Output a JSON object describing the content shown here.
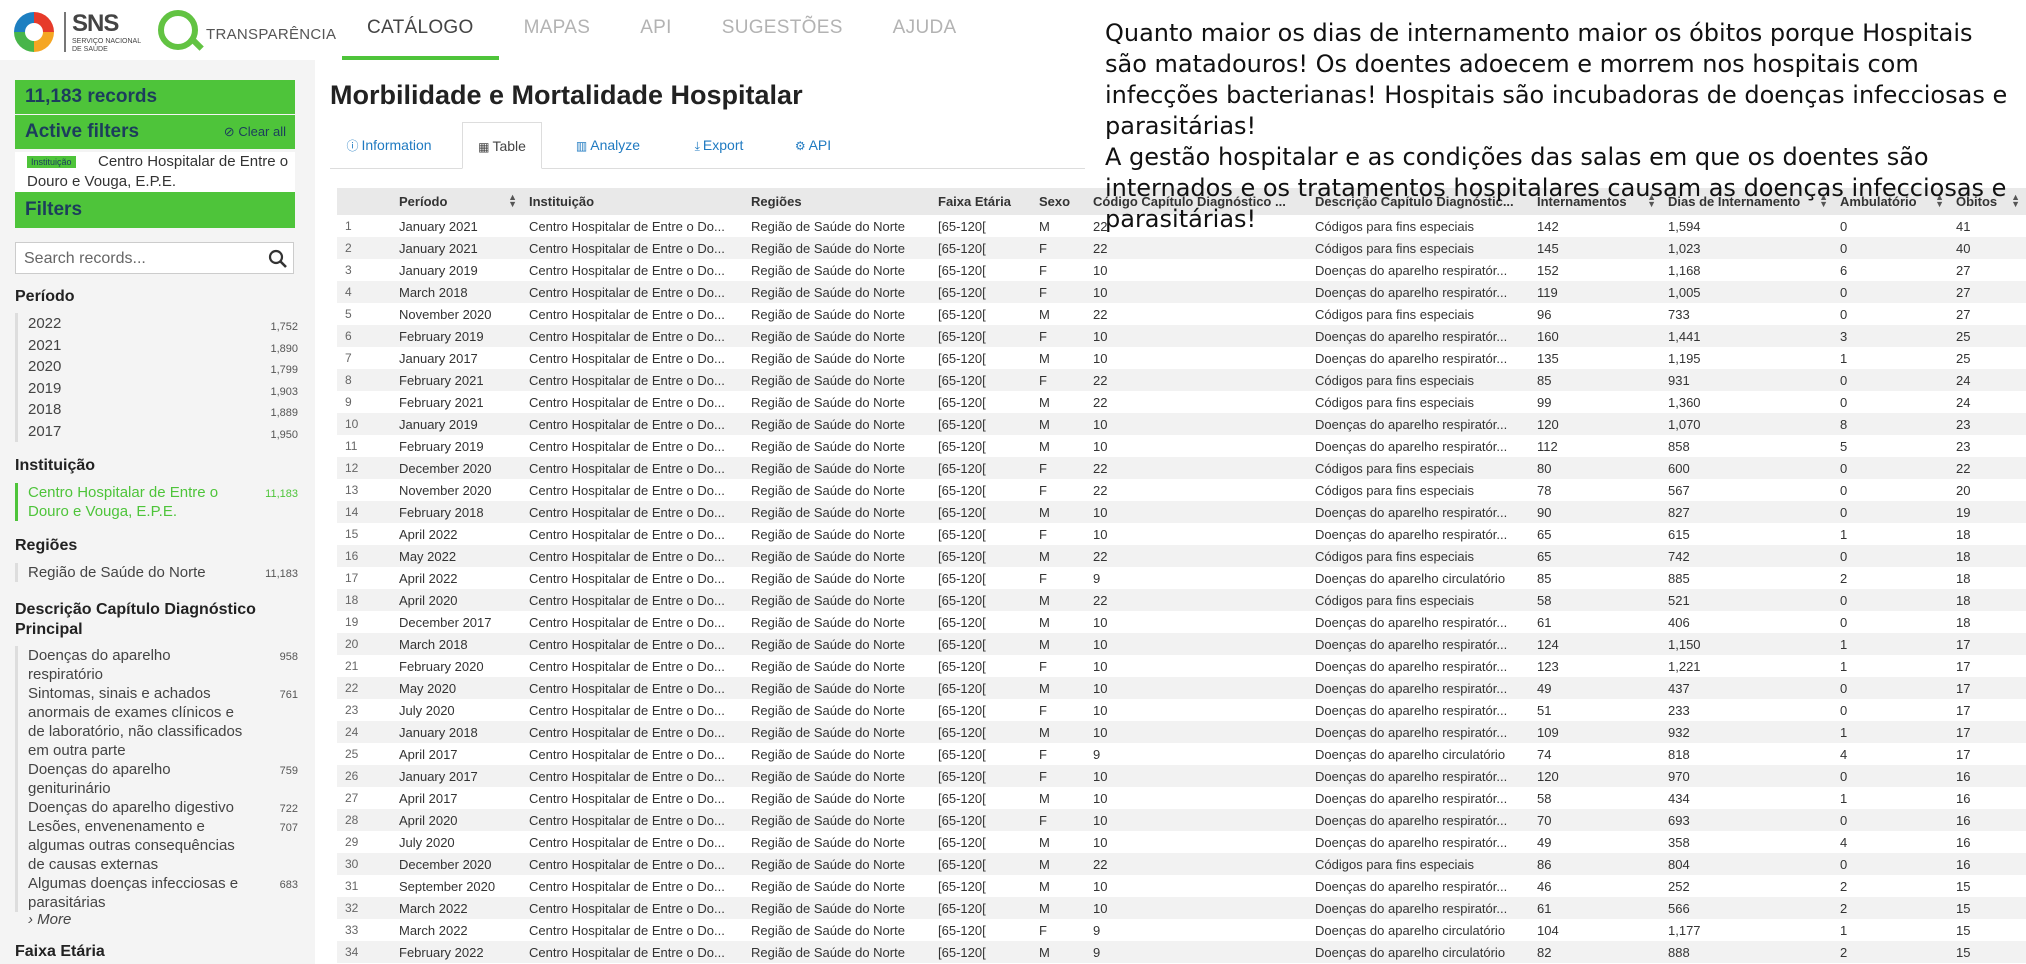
{
  "brand": {
    "sns_title": "SNS",
    "sns_subtitle": "SERVIÇO NACIONAL DE SAÚDE",
    "transparencia": "TRANSPARÊNCIA"
  },
  "nav": {
    "items": [
      "CATÁLOGO",
      "MAPAS",
      "API",
      "SUGESTÕES",
      "AJUDA"
    ],
    "active": "CATÁLOGO"
  },
  "sidebar": {
    "records": "11,183 records",
    "active_filters": "Active filters",
    "clear_all": "Clear all",
    "filter_tag": "Instituição",
    "filter_value": "Centro Hospitalar de Entre o Douro e Vouga, E.P.E.",
    "filters": "Filters",
    "search_placeholder": "Search records...",
    "facets": {
      "periodo": {
        "title": "Período",
        "items": [
          {
            "label": "2022",
            "count": "1,752"
          },
          {
            "label": "2021",
            "count": "1,890"
          },
          {
            "label": "2020",
            "count": "1,799"
          },
          {
            "label": "2019",
            "count": "1,903"
          },
          {
            "label": "2018",
            "count": "1,889"
          },
          {
            "label": "2017",
            "count": "1,950"
          }
        ]
      },
      "instituicao": {
        "title": "Instituição",
        "items": [
          {
            "label": "Centro Hospitalar de Entre o Douro e Vouga, E.P.E.",
            "count": "11,183"
          }
        ]
      },
      "regioes": {
        "title": "Regiões",
        "items": [
          {
            "label": "Região de Saúde do Norte",
            "count": "11,183"
          }
        ]
      },
      "descricao": {
        "title": "Descrição Capítulo Diagnóstico Principal",
        "items": [
          {
            "label": "Doenças do aparelho respiratório",
            "count": "958"
          },
          {
            "label": "Sintomas, sinais e achados anormais de exames clínicos e de laboratório, não classificados em outra parte",
            "count": "761"
          },
          {
            "label": "Doenças do aparelho geniturinário",
            "count": "759"
          },
          {
            "label": "Doenças do aparelho digestivo",
            "count": "722"
          },
          {
            "label": "Lesões, envenenamento e algumas outras consequências de causas externas",
            "count": "707"
          },
          {
            "label": "Algumas doenças infecciosas e parasitárias",
            "count": "683"
          }
        ],
        "more": "› More"
      },
      "faixa": {
        "title": "Faixa Etária"
      }
    }
  },
  "main": {
    "title": "Morbilidade e Mortalidade Hospitalar",
    "tabs": [
      {
        "label": "Information",
        "icon": "info-icon"
      },
      {
        "label": "Table",
        "icon": "table-icon"
      },
      {
        "label": "Analyze",
        "icon": "bar-chart-icon"
      },
      {
        "label": "Export",
        "icon": "download-icon"
      },
      {
        "label": "API",
        "icon": "gears-icon"
      }
    ],
    "active_tab": "Table"
  },
  "table": {
    "headers": [
      "Período",
      "Instituição",
      "Regiões",
      "Faixa Etária",
      "Sexo",
      "Código Capítulo Diagnóstico ...",
      "Descrição Capítulo Diagnóstic...",
      "Internamentos",
      "Dias de Internamento",
      "Ambulatório",
      "Óbitos"
    ],
    "rows": [
      [
        "1",
        "January 2021",
        "Centro Hospitalar de Entre o Do...",
        "Região de Saúde do Norte",
        "[65-120[",
        "M",
        "22",
        "Códigos para fins especiais",
        "142",
        "1,594",
        "0",
        "41"
      ],
      [
        "2",
        "January 2021",
        "Centro Hospitalar de Entre o Do...",
        "Região de Saúde do Norte",
        "[65-120[",
        "F",
        "22",
        "Códigos para fins especiais",
        "145",
        "1,023",
        "0",
        "40"
      ],
      [
        "3",
        "January 2019",
        "Centro Hospitalar de Entre o Do...",
        "Região de Saúde do Norte",
        "[65-120[",
        "F",
        "10",
        "Doenças do aparelho respiratór...",
        "152",
        "1,168",
        "6",
        "27"
      ],
      [
        "4",
        "March 2018",
        "Centro Hospitalar de Entre o Do...",
        "Região de Saúde do Norte",
        "[65-120[",
        "F",
        "10",
        "Doenças do aparelho respiratór...",
        "119",
        "1,005",
        "0",
        "27"
      ],
      [
        "5",
        "November 2020",
        "Centro Hospitalar de Entre o Do...",
        "Região de Saúde do Norte",
        "[65-120[",
        "M",
        "22",
        "Códigos para fins especiais",
        "96",
        "733",
        "0",
        "27"
      ],
      [
        "6",
        "February 2019",
        "Centro Hospitalar de Entre o Do...",
        "Região de Saúde do Norte",
        "[65-120[",
        "F",
        "10",
        "Doenças do aparelho respiratór...",
        "160",
        "1,441",
        "3",
        "25"
      ],
      [
        "7",
        "January 2017",
        "Centro Hospitalar de Entre o Do...",
        "Região de Saúde do Norte",
        "[65-120[",
        "M",
        "10",
        "Doenças do aparelho respiratór...",
        "135",
        "1,195",
        "1",
        "25"
      ],
      [
        "8",
        "February 2021",
        "Centro Hospitalar de Entre o Do...",
        "Região de Saúde do Norte",
        "[65-120[",
        "F",
        "22",
        "Códigos para fins especiais",
        "85",
        "931",
        "0",
        "24"
      ],
      [
        "9",
        "February 2021",
        "Centro Hospitalar de Entre o Do...",
        "Região de Saúde do Norte",
        "[65-120[",
        "M",
        "22",
        "Códigos para fins especiais",
        "99",
        "1,360",
        "0",
        "24"
      ],
      [
        "10",
        "January 2019",
        "Centro Hospitalar de Entre o Do...",
        "Região de Saúde do Norte",
        "[65-120[",
        "M",
        "10",
        "Doenças do aparelho respiratór...",
        "120",
        "1,070",
        "8",
        "23"
      ],
      [
        "11",
        "February 2019",
        "Centro Hospitalar de Entre o Do...",
        "Região de Saúde do Norte",
        "[65-120[",
        "M",
        "10",
        "Doenças do aparelho respiratór...",
        "112",
        "858",
        "5",
        "23"
      ],
      [
        "12",
        "December 2020",
        "Centro Hospitalar de Entre o Do...",
        "Região de Saúde do Norte",
        "[65-120[",
        "F",
        "22",
        "Códigos para fins especiais",
        "80",
        "600",
        "0",
        "22"
      ],
      [
        "13",
        "November 2020",
        "Centro Hospitalar de Entre o Do...",
        "Região de Saúde do Norte",
        "[65-120[",
        "F",
        "22",
        "Códigos para fins especiais",
        "78",
        "567",
        "0",
        "20"
      ],
      [
        "14",
        "February 2018",
        "Centro Hospitalar de Entre o Do...",
        "Região de Saúde do Norte",
        "[65-120[",
        "M",
        "10",
        "Doenças do aparelho respiratór...",
        "90",
        "827",
        "0",
        "19"
      ],
      [
        "15",
        "April 2022",
        "Centro Hospitalar de Entre o Do...",
        "Região de Saúde do Norte",
        "[65-120[",
        "F",
        "10",
        "Doenças do aparelho respiratór...",
        "65",
        "615",
        "1",
        "18"
      ],
      [
        "16",
        "May 2022",
        "Centro Hospitalar de Entre o Do...",
        "Região de Saúde do Norte",
        "[65-120[",
        "M",
        "22",
        "Códigos para fins especiais",
        "65",
        "742",
        "0",
        "18"
      ],
      [
        "17",
        "April 2022",
        "Centro Hospitalar de Entre o Do...",
        "Região de Saúde do Norte",
        "[65-120[",
        "F",
        "9",
        "Doenças do aparelho circulatório",
        "85",
        "885",
        "2",
        "18"
      ],
      [
        "18",
        "April 2020",
        "Centro Hospitalar de Entre o Do...",
        "Região de Saúde do Norte",
        "[65-120[",
        "M",
        "22",
        "Códigos para fins especiais",
        "58",
        "521",
        "0",
        "18"
      ],
      [
        "19",
        "December 2017",
        "Centro Hospitalar de Entre o Do...",
        "Região de Saúde do Norte",
        "[65-120[",
        "M",
        "10",
        "Doenças do aparelho respiratór...",
        "61",
        "406",
        "0",
        "18"
      ],
      [
        "20",
        "March 2018",
        "Centro Hospitalar de Entre o Do...",
        "Região de Saúde do Norte",
        "[65-120[",
        "M",
        "10",
        "Doenças do aparelho respiratór...",
        "124",
        "1,150",
        "1",
        "17"
      ],
      [
        "21",
        "February 2020",
        "Centro Hospitalar de Entre o Do...",
        "Região de Saúde do Norte",
        "[65-120[",
        "F",
        "10",
        "Doenças do aparelho respiratór...",
        "123",
        "1,221",
        "1",
        "17"
      ],
      [
        "22",
        "May 2020",
        "Centro Hospitalar de Entre o Do...",
        "Região de Saúde do Norte",
        "[65-120[",
        "M",
        "10",
        "Doenças do aparelho respiratór...",
        "49",
        "437",
        "0",
        "17"
      ],
      [
        "23",
        "July 2020",
        "Centro Hospitalar de Entre o Do...",
        "Região de Saúde do Norte",
        "[65-120[",
        "F",
        "10",
        "Doenças do aparelho respiratór...",
        "51",
        "233",
        "0",
        "17"
      ],
      [
        "24",
        "January 2018",
        "Centro Hospitalar de Entre o Do...",
        "Região de Saúde do Norte",
        "[65-120[",
        "M",
        "10",
        "Doenças do aparelho respiratór...",
        "109",
        "932",
        "1",
        "17"
      ],
      [
        "25",
        "April 2017",
        "Centro Hospitalar de Entre o Do...",
        "Região de Saúde do Norte",
        "[65-120[",
        "F",
        "9",
        "Doenças do aparelho circulatório",
        "74",
        "818",
        "4",
        "17"
      ],
      [
        "26",
        "January 2017",
        "Centro Hospitalar de Entre o Do...",
        "Região de Saúde do Norte",
        "[65-120[",
        "F",
        "10",
        "Doenças do aparelho respiratór...",
        "120",
        "970",
        "0",
        "16"
      ],
      [
        "27",
        "April 2017",
        "Centro Hospitalar de Entre o Do...",
        "Região de Saúde do Norte",
        "[65-120[",
        "M",
        "10",
        "Doenças do aparelho respiratór...",
        "58",
        "434",
        "1",
        "16"
      ],
      [
        "28",
        "April 2020",
        "Centro Hospitalar de Entre o Do...",
        "Região de Saúde do Norte",
        "[65-120[",
        "F",
        "10",
        "Doenças do aparelho respiratór...",
        "70",
        "693",
        "0",
        "16"
      ],
      [
        "29",
        "July 2020",
        "Centro Hospitalar de Entre o Do...",
        "Região de Saúde do Norte",
        "[65-120[",
        "M",
        "10",
        "Doenças do aparelho respiratór...",
        "49",
        "358",
        "4",
        "16"
      ],
      [
        "30",
        "December 2020",
        "Centro Hospitalar de Entre o Do...",
        "Região de Saúde do Norte",
        "[65-120[",
        "M",
        "22",
        "Códigos para fins especiais",
        "86",
        "804",
        "0",
        "16"
      ],
      [
        "31",
        "September 2020",
        "Centro Hospitalar de Entre o Do...",
        "Região de Saúde do Norte",
        "[65-120[",
        "M",
        "10",
        "Doenças do aparelho respiratór...",
        "46",
        "252",
        "2",
        "15"
      ],
      [
        "32",
        "March 2022",
        "Centro Hospitalar de Entre o Do...",
        "Região de Saúde do Norte",
        "[65-120[",
        "M",
        "10",
        "Doenças do aparelho respiratór...",
        "61",
        "566",
        "2",
        "15"
      ],
      [
        "33",
        "March 2022",
        "Centro Hospitalar de Entre o Do...",
        "Região de Saúde do Norte",
        "[65-120[",
        "F",
        "9",
        "Doenças do aparelho circulatório",
        "104",
        "1,177",
        "1",
        "15"
      ],
      [
        "34",
        "February 2022",
        "Centro Hospitalar de Entre o Do...",
        "Região de Saúde do Norte",
        "[65-120[",
        "M",
        "9",
        "Doenças do aparelho circulatório",
        "82",
        "888",
        "2",
        "15"
      ]
    ]
  },
  "overlay": {
    "lines": [
      "Quanto maior os dias de internamento maior os óbitos porque Hospitais são matadouros! Os doentes adoecem e morrem nos hospitais com infecções bacterianas! Hospitais são incubadoras de doenças infecciosas e parasitárias!",
      "A gestão hospitalar e as condições das salas em que os doentes são internados e os tratamentos hospitalares causam as doenças infecciosas e parasitárias!"
    ]
  },
  "colors": {
    "accent_green": "#4ec43a",
    "link_blue": "#1f7ac1",
    "label_navy": "#1c3d5c"
  }
}
